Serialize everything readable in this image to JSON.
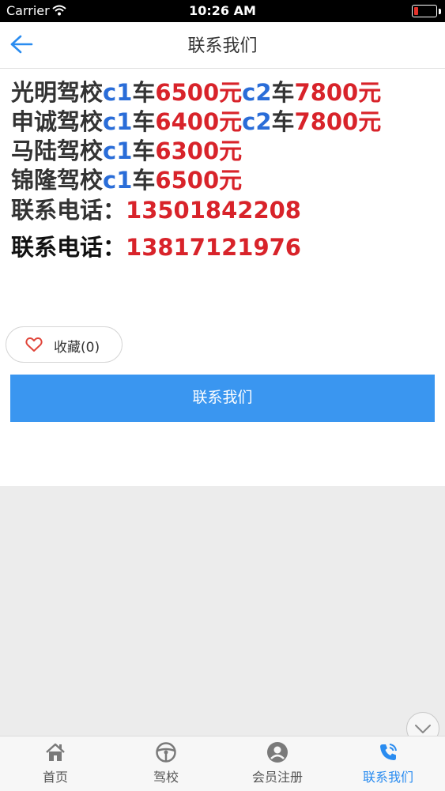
{
  "status_bar": {
    "carrier": "Carrier",
    "time": "10:26 AM",
    "icons": [
      "wifi-icon",
      "battery-icon"
    ],
    "battery_color": "#e5322b"
  },
  "nav": {
    "title": "联系我们",
    "back_icon": "back-arrow-icon"
  },
  "info": {
    "lines": [
      {
        "school": "光明驾校",
        "c1": "c1",
        "c1_unit": "车",
        "c1_price": "6500元",
        "c2": "c2",
        "c2_unit": "车",
        "c2_price": "7800元"
      },
      {
        "school": "申诚驾校",
        "c1": "c1",
        "c1_unit": "车",
        "c1_price": "6400元",
        "c2": "c2",
        "c2_unit": "车",
        "c2_price": "7800元"
      },
      {
        "school": "马陆驾校",
        "c1": "c1",
        "c1_unit": "车",
        "c1_price": "6300元"
      },
      {
        "school": "锦隆驾校",
        "c1": "c1",
        "c1_unit": "车",
        "c1_price": "6500元"
      }
    ],
    "phones": [
      {
        "label": "联系电话：",
        "number": "13501842208"
      },
      {
        "label": "联系电话：",
        "number": "13817121976"
      }
    ]
  },
  "favorite": {
    "label": "收藏(0)",
    "icon": "heart-icon"
  },
  "contact_button": {
    "label": "联系我们"
  },
  "scroll_button": {
    "icon": "chevron-down-icon"
  },
  "tabbar": {
    "active_color": "#2a8cf0",
    "items": [
      {
        "label": "首页",
        "icon": "home-icon"
      },
      {
        "label": "驾校",
        "icon": "steering-wheel-icon"
      },
      {
        "label": "会员注册",
        "icon": "user-icon"
      },
      {
        "label": "联系我们",
        "icon": "phone-icon",
        "active": true
      }
    ]
  },
  "colors": {
    "accent_blue": "#3a96f0",
    "price_red": "#d8232a",
    "car_type_blue": "#2a6dd8"
  }
}
